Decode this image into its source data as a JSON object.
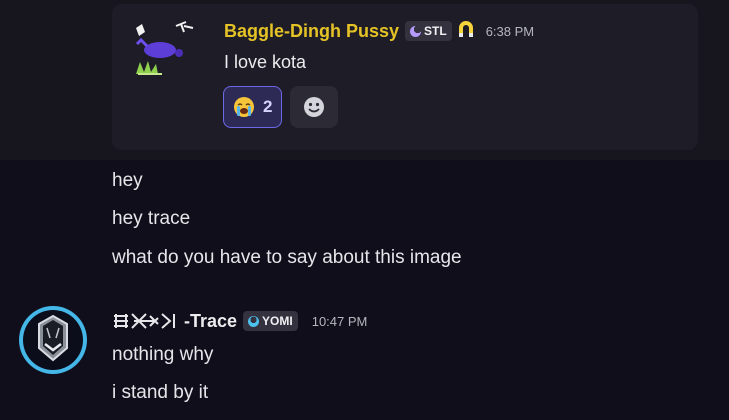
{
  "embed": {
    "username": "Baggle-Dingh Pussy",
    "tag": "STL",
    "time": "6:38 PM",
    "text": "I love kota",
    "reaction_count": "2",
    "username_color": "#e5c225"
  },
  "messages": {
    "m1": "hey",
    "m2": "hey trace",
    "m3": "what do you have to say about this image"
  },
  "trace": {
    "name_suffix": "-Trace",
    "tag": "YOMI",
    "time": "10:47 PM",
    "line1": "nothing why",
    "line2": "i stand by it"
  },
  "icons": {
    "reaction_emoji": "loudly-crying-face",
    "add_reaction": "smiley-icon",
    "badge": "magnet-icon"
  }
}
